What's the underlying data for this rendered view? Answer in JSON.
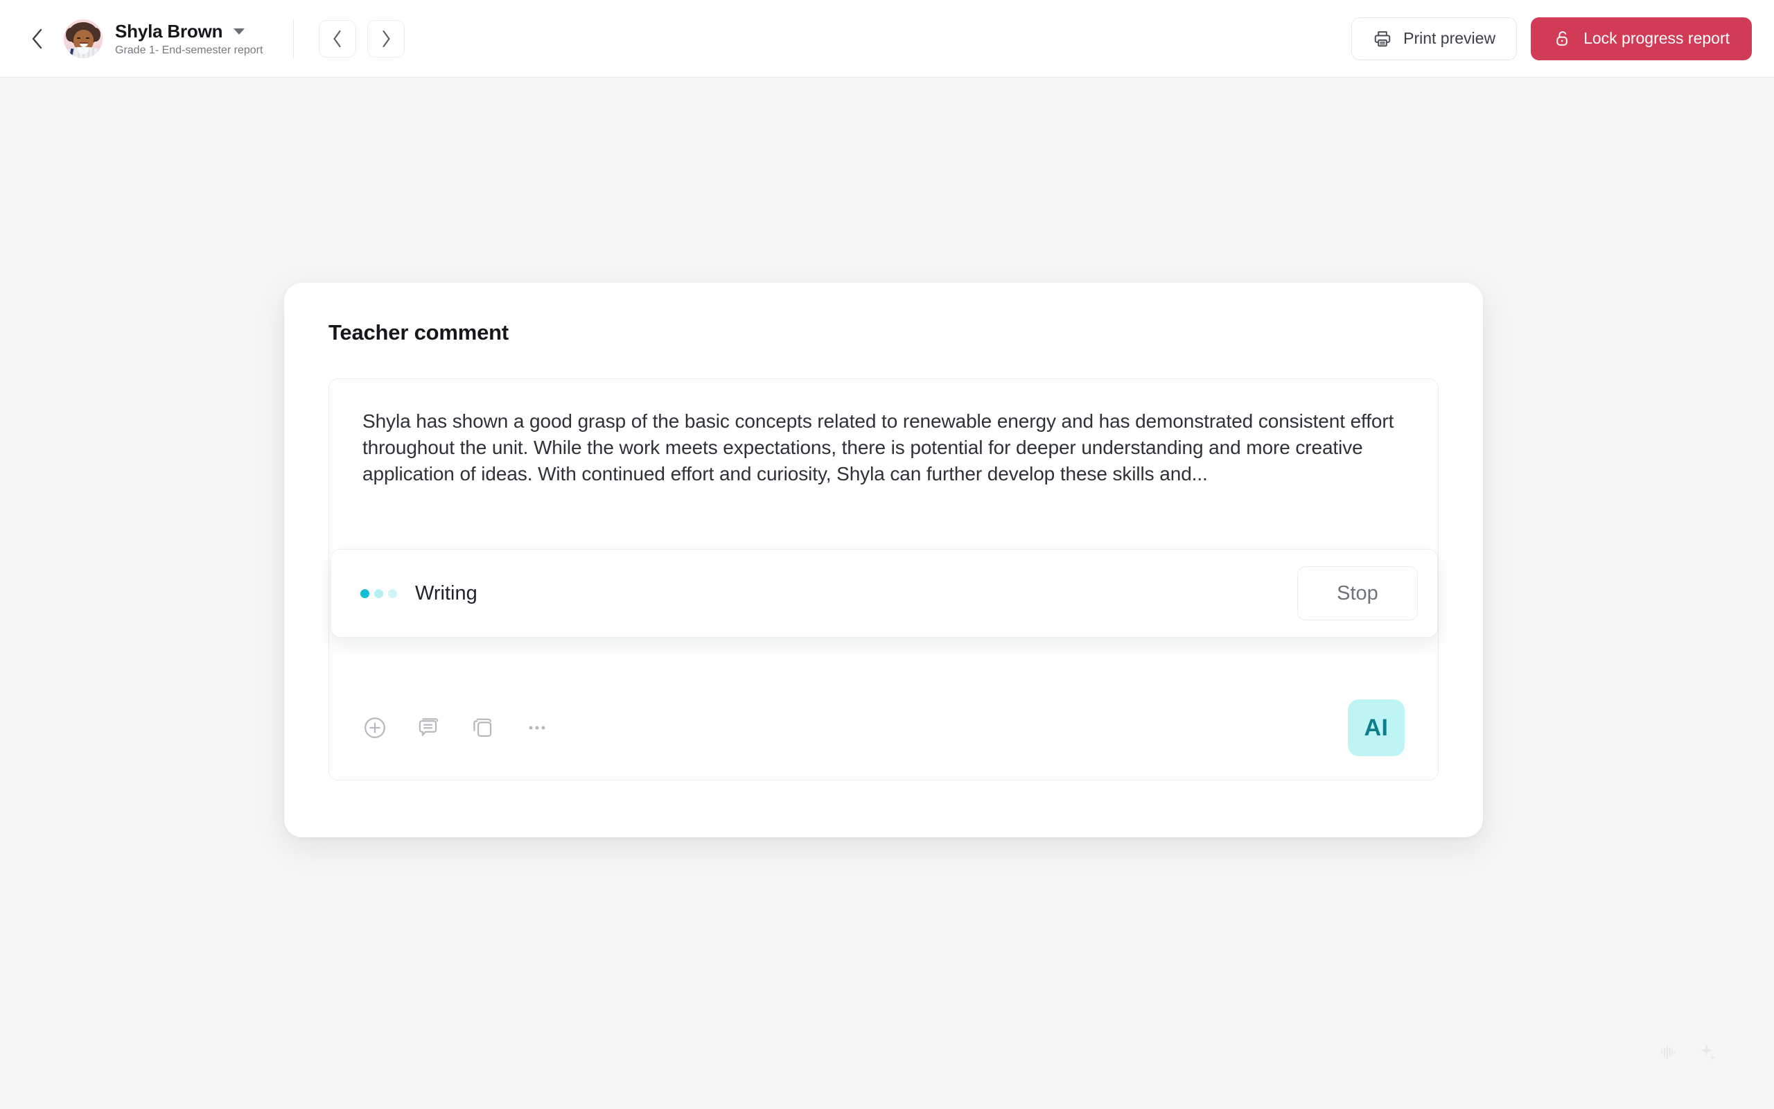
{
  "header": {
    "back_icon": "chevron-left-icon",
    "student": {
      "name": "Shyla Brown",
      "subtitle": "Grade 1- End-semester report",
      "avatar_icon": "student-avatar",
      "dropdown_icon": "caret-down-icon"
    },
    "nav": {
      "prev_icon": "chevron-left-icon",
      "next_icon": "chevron-right-icon"
    },
    "print_button": {
      "label": "Print preview",
      "icon": "printer-icon"
    },
    "lock_button": {
      "label": "Lock progress report",
      "icon": "lock-icon",
      "color": "#d13b55"
    }
  },
  "card": {
    "title": "Teacher comment",
    "comment": "Shyla has shown a good grasp of the basic concepts related to renewable energy and has demonstrated consistent effort throughout the unit. While the work meets expectations, there is potential for deeper understanding and more creative application of ideas. With continued effort and curiosity, Shyla can further develop these skills and...",
    "generating": {
      "status_label": "Writing",
      "stop_label": "Stop",
      "dots_icon": "loading-dots-icon",
      "dot_colors": [
        "#13bfd4",
        "#b6f0f3",
        "#cef5f7"
      ]
    },
    "toolbar": {
      "add_icon": "plus-circle-icon",
      "comment_icon": "chat-bubble-icon",
      "copy_icon": "copy-icon",
      "more_icon": "more-horizontal-icon",
      "ai_badge_label": "AI",
      "ai_badge_bg": "#bff4f5",
      "ai_badge_fg": "#0d7f8c"
    }
  },
  "floating": {
    "voice_icon": "waveform-icon",
    "sparkle_icon": "sparkle-icon"
  },
  "theme": {
    "page_bg": "#f6f6f6",
    "header_bg": "#ffffff",
    "card_bg": "#ffffff",
    "accent_red": "#d13b55",
    "accent_cyan": "#13bfd4"
  }
}
